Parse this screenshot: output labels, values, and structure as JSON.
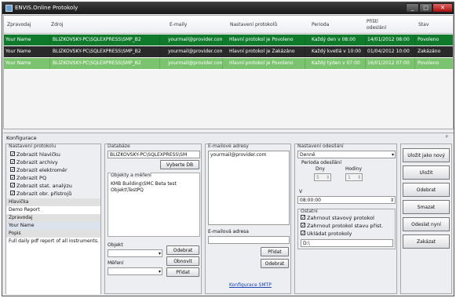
{
  "window": {
    "title": "ENVIS.Online Protokoly",
    "min": "_",
    "max": "□",
    "close": "✕"
  },
  "grid": {
    "headers": {
      "zpravodaj": "Zpravodaj",
      "zdroj": "Zdroj",
      "emaily": "E-maily",
      "nastaveni": "Nastavení protokolů",
      "perioda": "Perioda",
      "pristi": "Příští odeslání",
      "stav": "Stav"
    },
    "rows": [
      {
        "zpravodaj": "Your Name",
        "zdroj": "BLIZKOVSKY-PC\\SQLEXPRESS\\SMP_B2",
        "email": "yourmail@provider.com",
        "nastaveni": "Hlavní protokol je Povoleno",
        "perioda": "Každý den v 08:00",
        "pristi": "14/01/2012 08:00",
        "stav": "Povoleno"
      },
      {
        "zpravodaj": "Your Name",
        "zdroj": "BLIZKOVSKY-PC\\SQLEXPRESS\\SMP_B2",
        "email": "yourmail@provider.com",
        "nastaveni": "Hlavní protokol je Zakázáno",
        "perioda": "Každý kvetlá v 10:00",
        "pristi": "01/04/2012 10:00",
        "stav": "Zakázáno"
      },
      {
        "zpravodaj": "Your Name",
        "zdroj": "BLIZKOVSKY-PC\\SQLEXPRESS\\SMP_B2",
        "email": "yourmail@provider.com",
        "nastaveni": "Hlavní protokol je Povoleno",
        "perioda": "Každý týden v 07:00",
        "pristi": "16/01/2012 07:00",
        "stav": "Povoleno"
      }
    ]
  },
  "konfigurace": {
    "title": "Konfigurace",
    "pin": "ᵖ",
    "nastaveni_protokolu": {
      "label": "Nastavení protokolu",
      "checks": [
        "Zobrazit hlavičku",
        "Zobrazit archivy",
        "Zobrazit elektroměr",
        "Zobrazit PQ",
        "Zobrazit stat. analýzu",
        "Zobrazit obr. přístrojů"
      ],
      "props": [
        {
          "cat": "Hlavička",
          "val": "Demo Report"
        },
        {
          "cat": "Zpravodaj",
          "val": "Your Name"
        },
        {
          "cat": "Popis",
          "val": "Full daily pdf report of all instruments."
        }
      ]
    },
    "databaze": {
      "label": "Databáze",
      "value": "BLIZKOVSKY-PC\\SQLEXPRESS\\SM",
      "vybrat": "Vyberte DB",
      "objekty_label": "Objekty a měření",
      "objekty": [
        "KMB Building\\SMC Beta test",
        "Objekt\\TestPQ"
      ],
      "objekt_label": "Objekt",
      "mereni_label": "Měření",
      "odebrat": "Odebrat",
      "obnovit": "Obnovit",
      "pridat": "Přidat"
    },
    "emaily": {
      "label": "E-mailové adresy",
      "list": [
        "yourmail@provider.com"
      ],
      "adresa_label": "E-mailová adresa",
      "pridat": "Přidat",
      "odebrat": "Odebrat",
      "smtp": "Konfigurace SMTP"
    },
    "odesilani": {
      "label": "Nastavení odesílání",
      "perioda": "Denně",
      "perioda_label": "Perioda odesílání",
      "dny_label": "Dny",
      "hodiny_label": "Hodiny",
      "dny": "5",
      "hodiny": "1",
      "v_label": "V",
      "cas": "08:00:00",
      "ostatni_label": "Ostatní",
      "checks": [
        "Zahrnout stavový protokol",
        "Zahrnout protokol stavu přist.",
        "Ukládat protokoly"
      ],
      "cesta": "D:\\"
    },
    "buttons": [
      "Uložit jako nový",
      "Uložit",
      "Odebrat",
      "Smazat",
      "Odeslat nyní",
      "Zakázat"
    ]
  }
}
